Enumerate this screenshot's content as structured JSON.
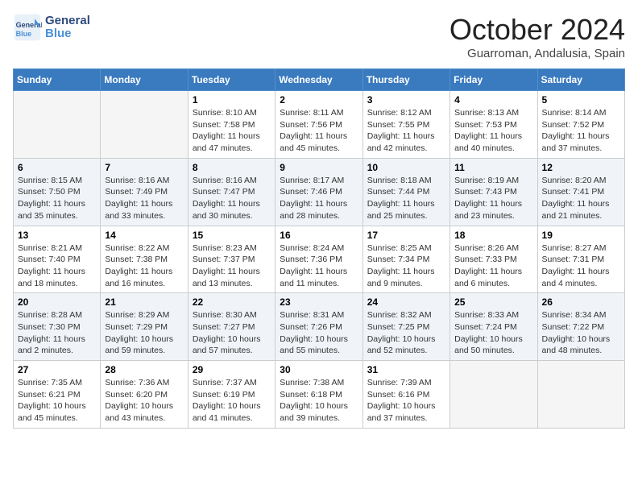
{
  "header": {
    "logo_line1": "General",
    "logo_line2": "Blue",
    "title": "October 2024",
    "location": "Guarroman, Andalusia, Spain"
  },
  "days_of_week": [
    "Sunday",
    "Monday",
    "Tuesday",
    "Wednesday",
    "Thursday",
    "Friday",
    "Saturday"
  ],
  "weeks": [
    [
      {
        "day": "",
        "info": ""
      },
      {
        "day": "",
        "info": ""
      },
      {
        "day": "1",
        "sunrise": "8:10 AM",
        "sunset": "7:58 PM",
        "daylight": "11 hours and 47 minutes."
      },
      {
        "day": "2",
        "sunrise": "8:11 AM",
        "sunset": "7:56 PM",
        "daylight": "11 hours and 45 minutes."
      },
      {
        "day": "3",
        "sunrise": "8:12 AM",
        "sunset": "7:55 PM",
        "daylight": "11 hours and 42 minutes."
      },
      {
        "day": "4",
        "sunrise": "8:13 AM",
        "sunset": "7:53 PM",
        "daylight": "11 hours and 40 minutes."
      },
      {
        "day": "5",
        "sunrise": "8:14 AM",
        "sunset": "7:52 PM",
        "daylight": "11 hours and 37 minutes."
      }
    ],
    [
      {
        "day": "6",
        "sunrise": "8:15 AM",
        "sunset": "7:50 PM",
        "daylight": "11 hours and 35 minutes."
      },
      {
        "day": "7",
        "sunrise": "8:16 AM",
        "sunset": "7:49 PM",
        "daylight": "11 hours and 33 minutes."
      },
      {
        "day": "8",
        "sunrise": "8:16 AM",
        "sunset": "7:47 PM",
        "daylight": "11 hours and 30 minutes."
      },
      {
        "day": "9",
        "sunrise": "8:17 AM",
        "sunset": "7:46 PM",
        "daylight": "11 hours and 28 minutes."
      },
      {
        "day": "10",
        "sunrise": "8:18 AM",
        "sunset": "7:44 PM",
        "daylight": "11 hours and 25 minutes."
      },
      {
        "day": "11",
        "sunrise": "8:19 AM",
        "sunset": "7:43 PM",
        "daylight": "11 hours and 23 minutes."
      },
      {
        "day": "12",
        "sunrise": "8:20 AM",
        "sunset": "7:41 PM",
        "daylight": "11 hours and 21 minutes."
      }
    ],
    [
      {
        "day": "13",
        "sunrise": "8:21 AM",
        "sunset": "7:40 PM",
        "daylight": "11 hours and 18 minutes."
      },
      {
        "day": "14",
        "sunrise": "8:22 AM",
        "sunset": "7:38 PM",
        "daylight": "11 hours and 16 minutes."
      },
      {
        "day": "15",
        "sunrise": "8:23 AM",
        "sunset": "7:37 PM",
        "daylight": "11 hours and 13 minutes."
      },
      {
        "day": "16",
        "sunrise": "8:24 AM",
        "sunset": "7:36 PM",
        "daylight": "11 hours and 11 minutes."
      },
      {
        "day": "17",
        "sunrise": "8:25 AM",
        "sunset": "7:34 PM",
        "daylight": "11 hours and 9 minutes."
      },
      {
        "day": "18",
        "sunrise": "8:26 AM",
        "sunset": "7:33 PM",
        "daylight": "11 hours and 6 minutes."
      },
      {
        "day": "19",
        "sunrise": "8:27 AM",
        "sunset": "7:31 PM",
        "daylight": "11 hours and 4 minutes."
      }
    ],
    [
      {
        "day": "20",
        "sunrise": "8:28 AM",
        "sunset": "7:30 PM",
        "daylight": "11 hours and 2 minutes."
      },
      {
        "day": "21",
        "sunrise": "8:29 AM",
        "sunset": "7:29 PM",
        "daylight": "10 hours and 59 minutes."
      },
      {
        "day": "22",
        "sunrise": "8:30 AM",
        "sunset": "7:27 PM",
        "daylight": "10 hours and 57 minutes."
      },
      {
        "day": "23",
        "sunrise": "8:31 AM",
        "sunset": "7:26 PM",
        "daylight": "10 hours and 55 minutes."
      },
      {
        "day": "24",
        "sunrise": "8:32 AM",
        "sunset": "7:25 PM",
        "daylight": "10 hours and 52 minutes."
      },
      {
        "day": "25",
        "sunrise": "8:33 AM",
        "sunset": "7:24 PM",
        "daylight": "10 hours and 50 minutes."
      },
      {
        "day": "26",
        "sunrise": "8:34 AM",
        "sunset": "7:22 PM",
        "daylight": "10 hours and 48 minutes."
      }
    ],
    [
      {
        "day": "27",
        "sunrise": "7:35 AM",
        "sunset": "6:21 PM",
        "daylight": "10 hours and 45 minutes."
      },
      {
        "day": "28",
        "sunrise": "7:36 AM",
        "sunset": "6:20 PM",
        "daylight": "10 hours and 43 minutes."
      },
      {
        "day": "29",
        "sunrise": "7:37 AM",
        "sunset": "6:19 PM",
        "daylight": "10 hours and 41 minutes."
      },
      {
        "day": "30",
        "sunrise": "7:38 AM",
        "sunset": "6:18 PM",
        "daylight": "10 hours and 39 minutes."
      },
      {
        "day": "31",
        "sunrise": "7:39 AM",
        "sunset": "6:16 PM",
        "daylight": "10 hours and 37 minutes."
      },
      {
        "day": "",
        "info": ""
      },
      {
        "day": "",
        "info": ""
      }
    ]
  ]
}
